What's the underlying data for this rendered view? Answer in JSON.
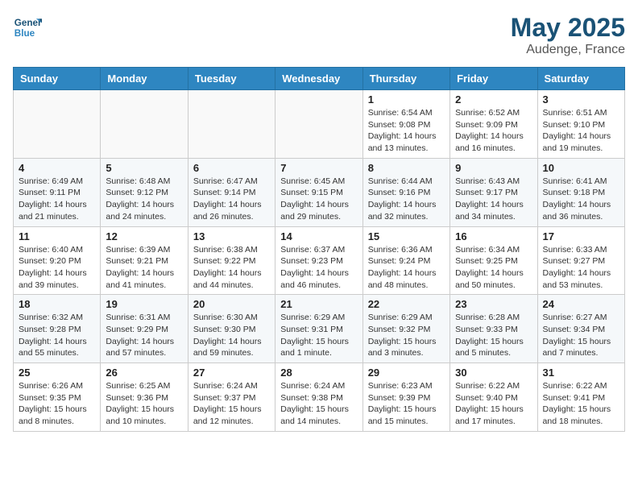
{
  "header": {
    "logo_line1": "General",
    "logo_line2": "Blue",
    "month": "May 2025",
    "location": "Audenge, France"
  },
  "weekdays": [
    "Sunday",
    "Monday",
    "Tuesday",
    "Wednesday",
    "Thursday",
    "Friday",
    "Saturday"
  ],
  "weeks": [
    [
      {
        "day": "",
        "info": ""
      },
      {
        "day": "",
        "info": ""
      },
      {
        "day": "",
        "info": ""
      },
      {
        "day": "",
        "info": ""
      },
      {
        "day": "1",
        "info": "Sunrise: 6:54 AM\nSunset: 9:08 PM\nDaylight: 14 hours\nand 13 minutes."
      },
      {
        "day": "2",
        "info": "Sunrise: 6:52 AM\nSunset: 9:09 PM\nDaylight: 14 hours\nand 16 minutes."
      },
      {
        "day": "3",
        "info": "Sunrise: 6:51 AM\nSunset: 9:10 PM\nDaylight: 14 hours\nand 19 minutes."
      }
    ],
    [
      {
        "day": "4",
        "info": "Sunrise: 6:49 AM\nSunset: 9:11 PM\nDaylight: 14 hours\nand 21 minutes."
      },
      {
        "day": "5",
        "info": "Sunrise: 6:48 AM\nSunset: 9:12 PM\nDaylight: 14 hours\nand 24 minutes."
      },
      {
        "day": "6",
        "info": "Sunrise: 6:47 AM\nSunset: 9:14 PM\nDaylight: 14 hours\nand 26 minutes."
      },
      {
        "day": "7",
        "info": "Sunrise: 6:45 AM\nSunset: 9:15 PM\nDaylight: 14 hours\nand 29 minutes."
      },
      {
        "day": "8",
        "info": "Sunrise: 6:44 AM\nSunset: 9:16 PM\nDaylight: 14 hours\nand 32 minutes."
      },
      {
        "day": "9",
        "info": "Sunrise: 6:43 AM\nSunset: 9:17 PM\nDaylight: 14 hours\nand 34 minutes."
      },
      {
        "day": "10",
        "info": "Sunrise: 6:41 AM\nSunset: 9:18 PM\nDaylight: 14 hours\nand 36 minutes."
      }
    ],
    [
      {
        "day": "11",
        "info": "Sunrise: 6:40 AM\nSunset: 9:20 PM\nDaylight: 14 hours\nand 39 minutes."
      },
      {
        "day": "12",
        "info": "Sunrise: 6:39 AM\nSunset: 9:21 PM\nDaylight: 14 hours\nand 41 minutes."
      },
      {
        "day": "13",
        "info": "Sunrise: 6:38 AM\nSunset: 9:22 PM\nDaylight: 14 hours\nand 44 minutes."
      },
      {
        "day": "14",
        "info": "Sunrise: 6:37 AM\nSunset: 9:23 PM\nDaylight: 14 hours\nand 46 minutes."
      },
      {
        "day": "15",
        "info": "Sunrise: 6:36 AM\nSunset: 9:24 PM\nDaylight: 14 hours\nand 48 minutes."
      },
      {
        "day": "16",
        "info": "Sunrise: 6:34 AM\nSunset: 9:25 PM\nDaylight: 14 hours\nand 50 minutes."
      },
      {
        "day": "17",
        "info": "Sunrise: 6:33 AM\nSunset: 9:27 PM\nDaylight: 14 hours\nand 53 minutes."
      }
    ],
    [
      {
        "day": "18",
        "info": "Sunrise: 6:32 AM\nSunset: 9:28 PM\nDaylight: 14 hours\nand 55 minutes."
      },
      {
        "day": "19",
        "info": "Sunrise: 6:31 AM\nSunset: 9:29 PM\nDaylight: 14 hours\nand 57 minutes."
      },
      {
        "day": "20",
        "info": "Sunrise: 6:30 AM\nSunset: 9:30 PM\nDaylight: 14 hours\nand 59 minutes."
      },
      {
        "day": "21",
        "info": "Sunrise: 6:29 AM\nSunset: 9:31 PM\nDaylight: 15 hours\nand 1 minute."
      },
      {
        "day": "22",
        "info": "Sunrise: 6:29 AM\nSunset: 9:32 PM\nDaylight: 15 hours\nand 3 minutes."
      },
      {
        "day": "23",
        "info": "Sunrise: 6:28 AM\nSunset: 9:33 PM\nDaylight: 15 hours\nand 5 minutes."
      },
      {
        "day": "24",
        "info": "Sunrise: 6:27 AM\nSunset: 9:34 PM\nDaylight: 15 hours\nand 7 minutes."
      }
    ],
    [
      {
        "day": "25",
        "info": "Sunrise: 6:26 AM\nSunset: 9:35 PM\nDaylight: 15 hours\nand 8 minutes."
      },
      {
        "day": "26",
        "info": "Sunrise: 6:25 AM\nSunset: 9:36 PM\nDaylight: 15 hours\nand 10 minutes."
      },
      {
        "day": "27",
        "info": "Sunrise: 6:24 AM\nSunset: 9:37 PM\nDaylight: 15 hours\nand 12 minutes."
      },
      {
        "day": "28",
        "info": "Sunrise: 6:24 AM\nSunset: 9:38 PM\nDaylight: 15 hours\nand 14 minutes."
      },
      {
        "day": "29",
        "info": "Sunrise: 6:23 AM\nSunset: 9:39 PM\nDaylight: 15 hours\nand 15 minutes."
      },
      {
        "day": "30",
        "info": "Sunrise: 6:22 AM\nSunset: 9:40 PM\nDaylight: 15 hours\nand 17 minutes."
      },
      {
        "day": "31",
        "info": "Sunrise: 6:22 AM\nSunset: 9:41 PM\nDaylight: 15 hours\nand 18 minutes."
      }
    ]
  ]
}
